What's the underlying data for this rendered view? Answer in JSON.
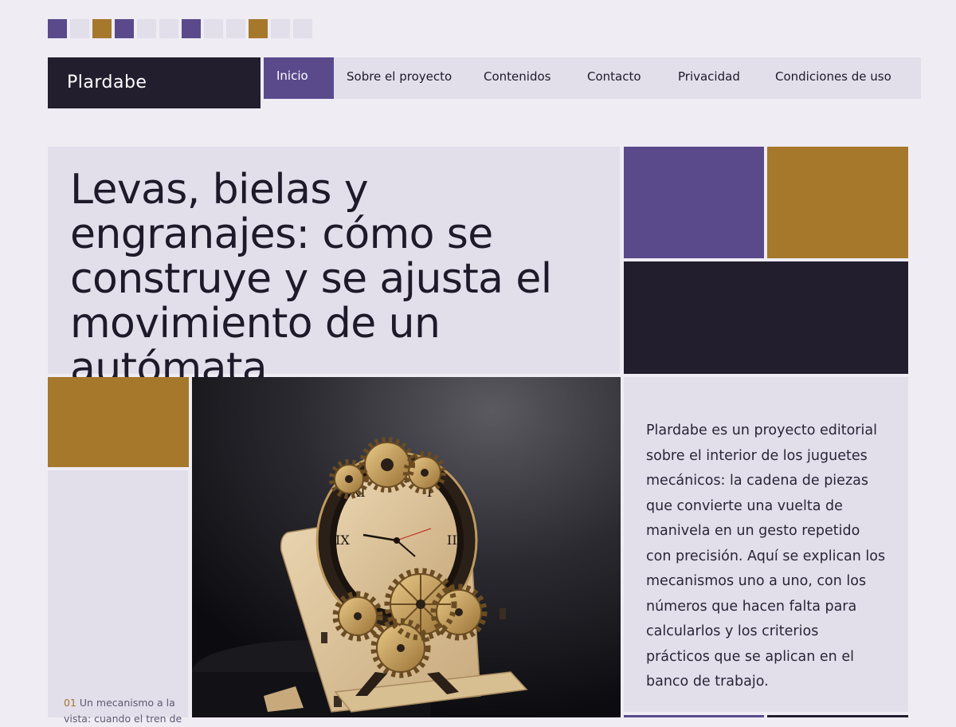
{
  "site": {
    "name": "Plardabe"
  },
  "nav": {
    "items": [
      {
        "label": "Inicio",
        "active": true
      },
      {
        "label": "Sobre el proyecto",
        "active": false
      },
      {
        "label": "Contenidos",
        "active": false
      },
      {
        "label": "Contacto",
        "active": false
      },
      {
        "label": "Privacidad",
        "active": false
      },
      {
        "label": "Condiciones de uso",
        "active": false
      }
    ]
  },
  "hero": {
    "title": "Levas, bielas y engranajes: cómo se construye y se ajusta el movimiento de un autómata"
  },
  "intro": {
    "text": "Plardabe es un proyecto editorial sobre el interior de los juguetes mecánicos: la cadena de piezas que convierte una vuelta de manivela en un gesto repetido con precisión. Aquí se explican los mecanismos uno a uno, con los números que hacen falta para calcularlos y los criterios prácticos que se aplican en el banco de trabajo."
  },
  "sidebar": {
    "caption_number": "01",
    "caption_text": "Un mecanismo a la vista: cuando el tren de"
  },
  "illustration": {
    "subject": "wooden-gear-clock-kit-icon"
  },
  "colors": {
    "accent": "#5a4a8c",
    "gold": "#a6782c",
    "dark": "#221e2e",
    "tile": "#e2dfeb",
    "background": "#efecf4"
  }
}
